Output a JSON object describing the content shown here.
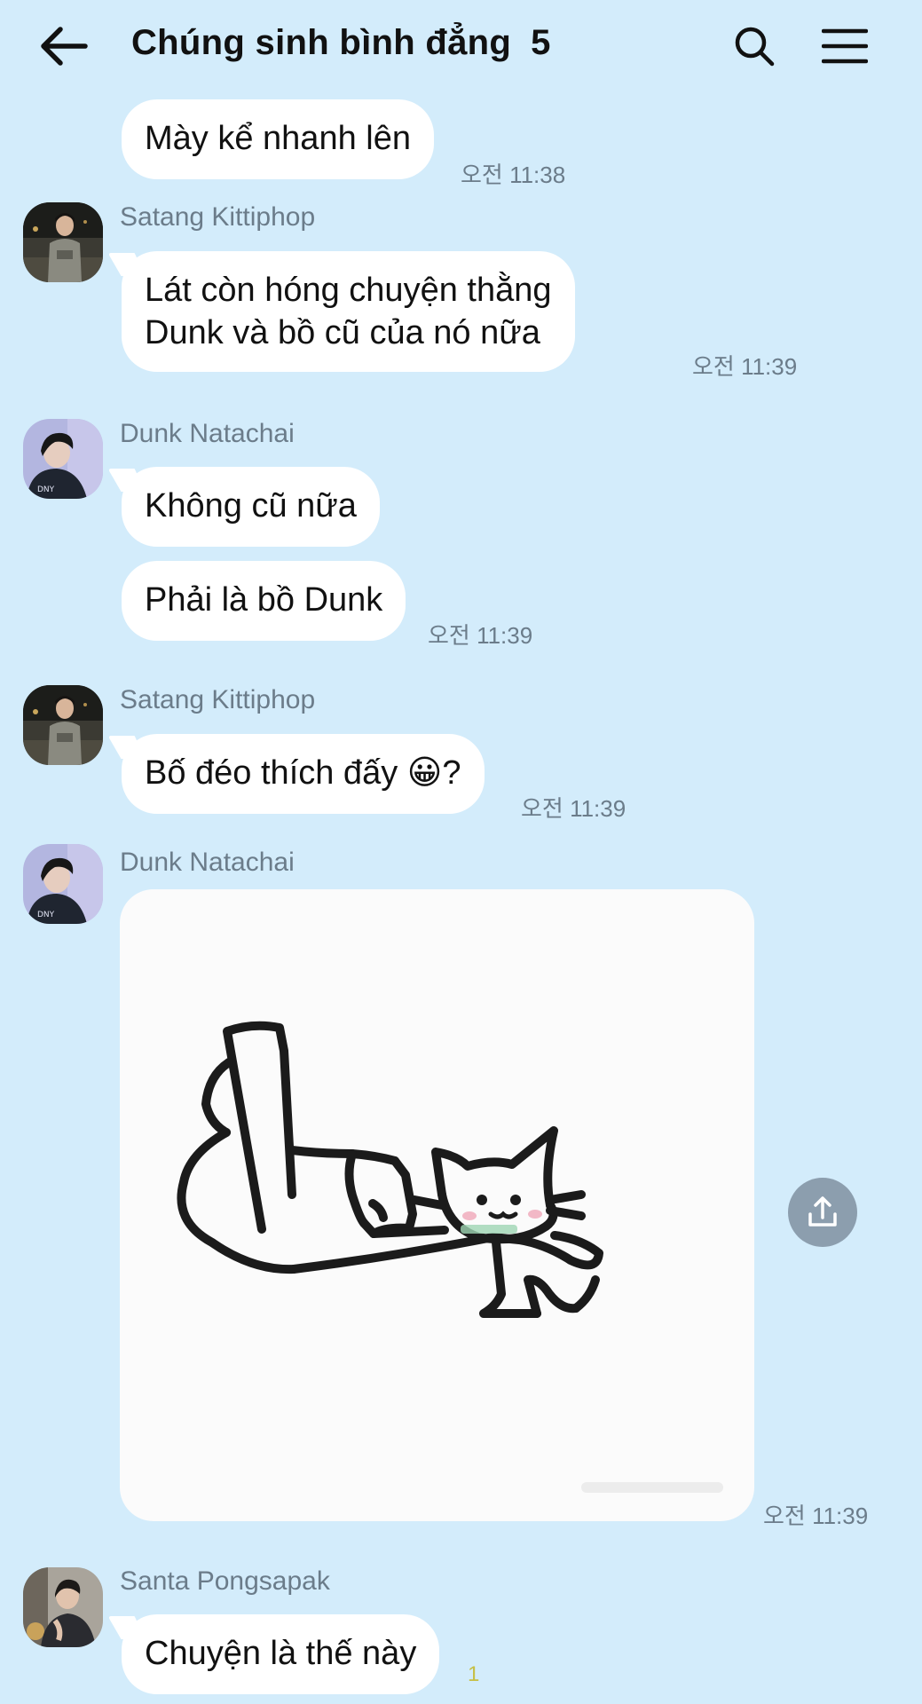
{
  "header": {
    "title": "Chúng sinh bình đẳng",
    "member_count": "5",
    "back_icon": "arrow-left-icon",
    "search_icon": "search-icon",
    "menu_icon": "hamburger-menu-icon"
  },
  "messages": [
    {
      "text": "Mày kể nhanh lên",
      "time": "오전 11:38"
    },
    {
      "sender": "Satang Kittiphop",
      "line1": "Lát còn hóng chuyện thằng",
      "line2": "Dunk và bồ cũ của nó nữa",
      "time": "오전 11:39"
    },
    {
      "sender": "Dunk Natachai",
      "text1": "Không cũ nữa",
      "text2": "Phải là bồ Dunk",
      "time": "오전 11:39"
    },
    {
      "sender": "Satang Kittiphop",
      "text": "Bố đéo thích đấy 😀?",
      "time": "오전 11:39"
    },
    {
      "sender": "Dunk Natachai",
      "image": "middle-finger-cat-sketch",
      "time": "오전 11:39",
      "share_icon": "share-upload-icon"
    },
    {
      "sender": "Santa Pongsapak",
      "text": "Chuyện là thế này",
      "read_count": "1"
    }
  ],
  "colors": {
    "background": "#d3ecfb",
    "bubble": "#ffffff",
    "meta_text": "#6b7c8a",
    "read_count": "#c6bf45"
  }
}
